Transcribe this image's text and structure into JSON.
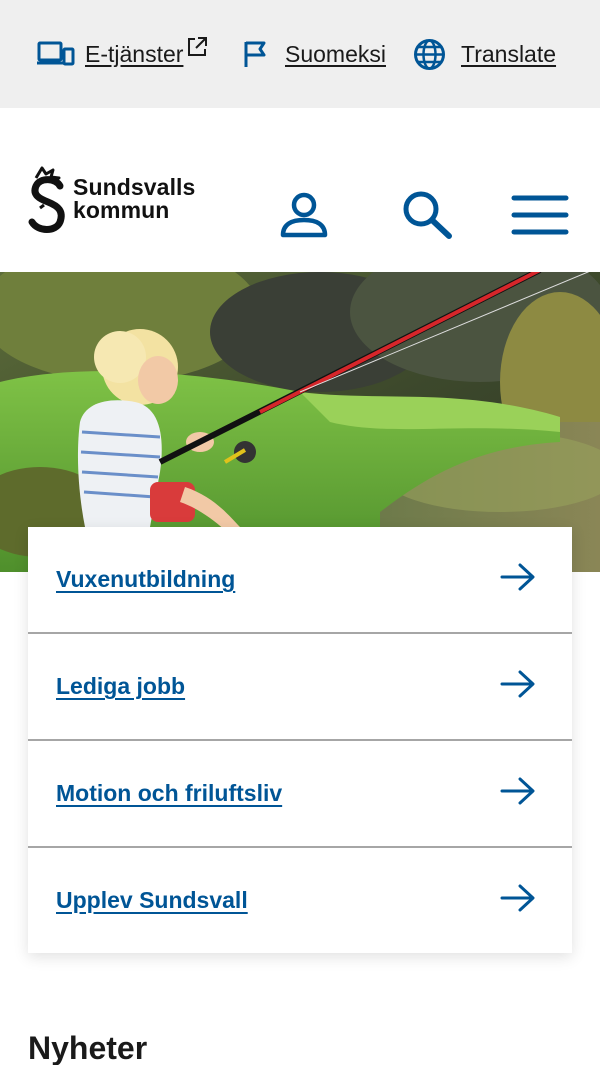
{
  "utility_nav": {
    "eservices_label": "E-tjänster",
    "finnish_label": "Suomeksi",
    "translate_label": "Translate"
  },
  "header": {
    "logo_line1": "Sundsvalls",
    "logo_line2": "kommun"
  },
  "quick_links": [
    {
      "label": "Vuxenutbildning"
    },
    {
      "label": "Lediga jobb"
    },
    {
      "label": "Motion och friluftsliv"
    },
    {
      "label": "Upplev Sundsvall"
    }
  ],
  "news_heading": "Nyheter",
  "colors": {
    "brand_blue": "#005596",
    "topbar_bg": "#efefef",
    "divider": "#a6a6a6"
  }
}
